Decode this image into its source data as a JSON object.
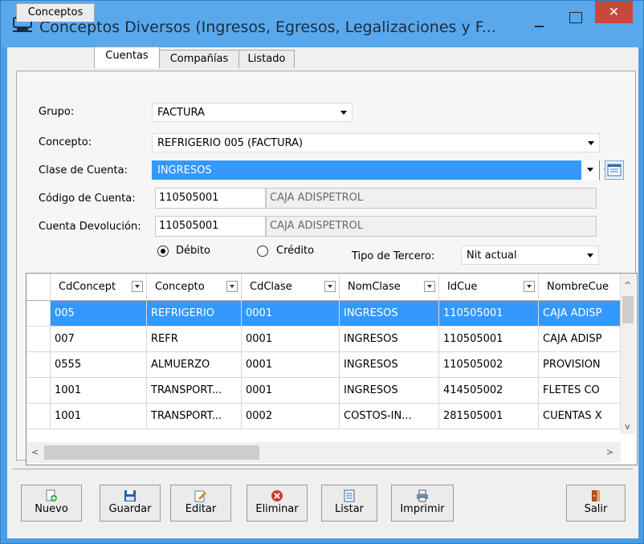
{
  "window": {
    "title": "Conceptos Diversos (Ingresos, Egresos, Legalizaciones y F...",
    "close_glyph": "✕"
  },
  "tabs": [
    {
      "label": "Conceptos"
    },
    {
      "label": "Cuentas"
    },
    {
      "label": "Compañías"
    },
    {
      "label": "Listado"
    }
  ],
  "form": {
    "grupo_label": "Grupo:",
    "grupo_value": "FACTURA",
    "concepto_label": "Concepto:",
    "concepto_value": "REFRIGERIO 005 (FACTURA)",
    "clase_label": "Clase de Cuenta:",
    "clase_value": "INGRESOS",
    "codigo_label": "Código de Cuenta:",
    "codigo_value": "110505001",
    "codigo_name": "CAJA ADISPETROL",
    "devolucion_label": "Cuenta Devolución:",
    "devolucion_value": "110505001",
    "devolucion_name": "CAJA ADISPETROL",
    "debito_label": "Débito",
    "credito_label": "Crédito",
    "selected_nature": "Débito",
    "tipo_tercero_label": "Tipo de Tercero:",
    "tipo_tercero_value": "Nit actual"
  },
  "grid": {
    "columns": [
      "CdConcept",
      "Concepto",
      "CdClase",
      "NomClase",
      "IdCue",
      "NombreCue"
    ],
    "rows": [
      [
        "005",
        "REFRIGERIO",
        "0001",
        "INGRESOS",
        "110505001",
        "CAJA ADISP"
      ],
      [
        "007",
        "REFR",
        "0001",
        "INGRESOS",
        "110505001",
        "CAJA ADISP"
      ],
      [
        "0555",
        "ALMUERZO",
        "0001",
        "INGRESOS",
        "110505002",
        "PROVISION"
      ],
      [
        "1001",
        "TRANSPORT...",
        "0001",
        "INGRESOS",
        "414505002",
        "FLETES  CO"
      ],
      [
        "1001",
        "TRANSPORT...",
        "0002",
        "COSTOS-IN...",
        "281505001",
        "CUENTAS X"
      ]
    ],
    "selected_row": 0,
    "scroll_left_glyph": "<",
    "scroll_right_glyph": ">",
    "scroll_up_glyph": "^",
    "scroll_down_glyph": "v"
  },
  "toolbar": {
    "nuevo": "Nuevo",
    "guardar": "Guardar",
    "editar": "Editar",
    "eliminar": "Eliminar",
    "listar": "Listar",
    "imprimir": "Imprimir",
    "salir": "Salir"
  },
  "colors": {
    "title_bar": "#5aa8ec",
    "close_button": "#c7473b",
    "selection": "#3399ff"
  },
  "icons": [
    "app-icon",
    "form-lookup-icon",
    "new-icon",
    "save-icon",
    "edit-icon",
    "delete-icon",
    "list-icon",
    "print-icon",
    "exit-icon"
  ]
}
